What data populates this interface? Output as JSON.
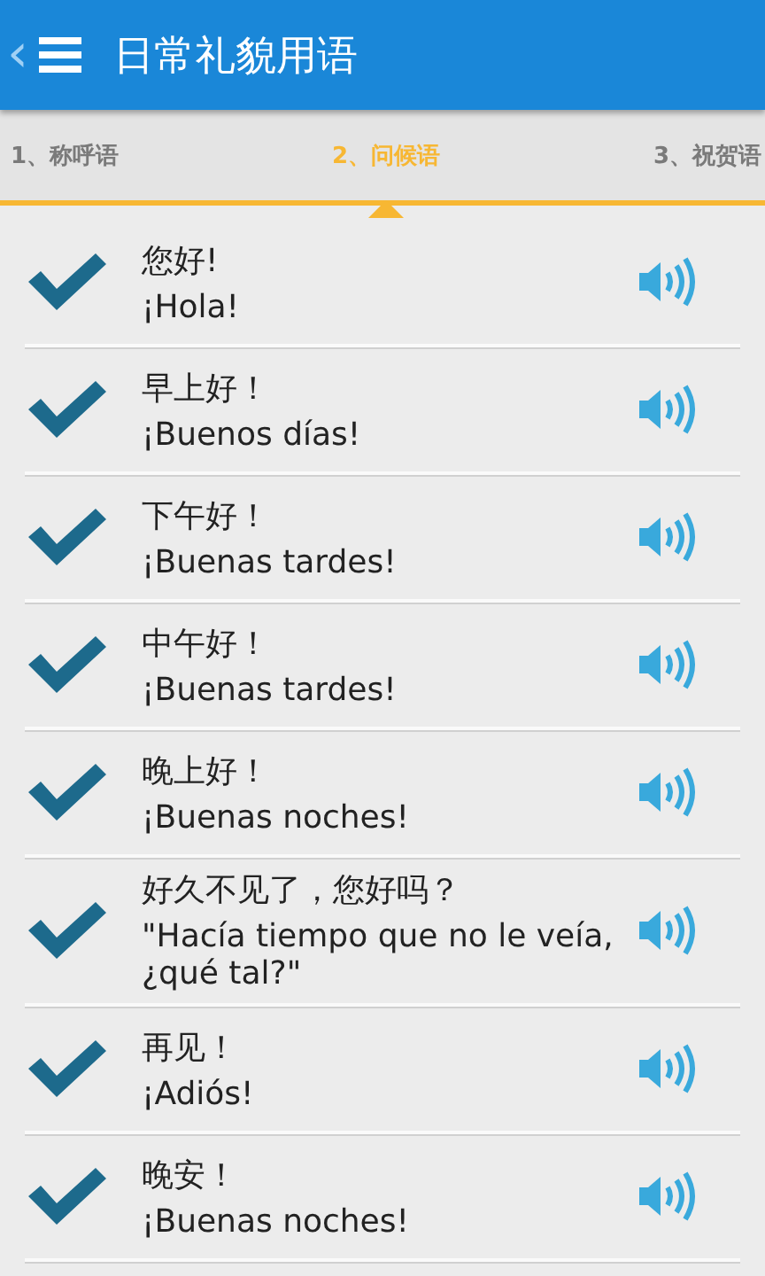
{
  "header": {
    "back": "‹",
    "title": "日常礼貌用语"
  },
  "tabs": [
    {
      "label": "1、称呼语",
      "selected": false
    },
    {
      "label": "2、问候语",
      "selected": true
    },
    {
      "label": "3、祝贺语",
      "selected": false
    }
  ],
  "phrases": [
    {
      "chinese": "您好!",
      "spanish": "¡Hola!",
      "checked": true
    },
    {
      "chinese": "早上好！",
      "spanish": "¡Buenos días!",
      "checked": true
    },
    {
      "chinese": "下午好！",
      "spanish": "¡Buenas tardes!",
      "checked": true
    },
    {
      "chinese": "中午好！",
      "spanish": "¡Buenas tardes!",
      "checked": true
    },
    {
      "chinese": "晚上好！",
      "spanish": "¡Buenas noches!",
      "checked": true
    },
    {
      "chinese": "好久不见了，您好吗？",
      "spanish": "\"Hacía tiempo que no le veía, ¿qué tal?\"",
      "checked": true
    },
    {
      "chinese": "再见！",
      "spanish": "¡Adiós!",
      "checked": true
    },
    {
      "chinese": "晚安！",
      "spanish": "¡Buenas noches!",
      "checked": true
    }
  ]
}
